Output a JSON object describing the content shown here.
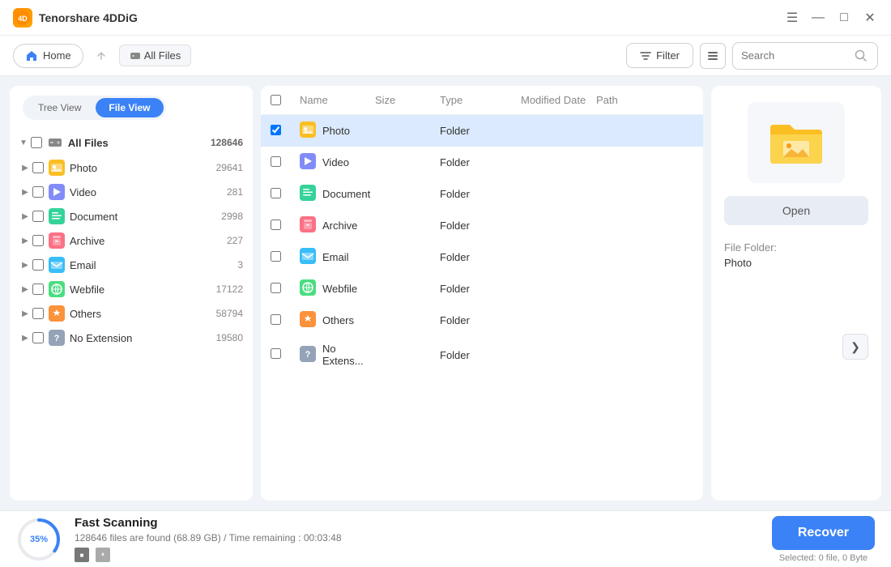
{
  "app": {
    "title": "Tenorshare 4DDiG",
    "logo_text": "4D"
  },
  "titlebar_controls": {
    "menu_label": "☰",
    "minimize_label": "—",
    "maximize_label": "□",
    "close_label": "✕"
  },
  "toolbar": {
    "home_label": "Home",
    "path_label": "All Files",
    "filter_label": "Filter",
    "search_placeholder": "Search"
  },
  "sidebar": {
    "tree_view_label": "Tree View",
    "file_view_label": "File View",
    "root": {
      "label": "All Files",
      "count": "128646"
    },
    "items": [
      {
        "id": "photo",
        "label": "Photo",
        "count": "29641",
        "icon_type": "photo"
      },
      {
        "id": "video",
        "label": "Video",
        "count": "281",
        "icon_type": "video"
      },
      {
        "id": "document",
        "label": "Document",
        "count": "2998",
        "icon_type": "document"
      },
      {
        "id": "archive",
        "label": "Archive",
        "count": "227",
        "icon_type": "archive"
      },
      {
        "id": "email",
        "label": "Email",
        "count": "3",
        "icon_type": "email"
      },
      {
        "id": "webfile",
        "label": "Webfile",
        "count": "17122",
        "icon_type": "webfile"
      },
      {
        "id": "others",
        "label": "Others",
        "count": "58794",
        "icon_type": "others"
      },
      {
        "id": "noext",
        "label": "No Extension",
        "count": "19580",
        "icon_type": "noext"
      }
    ]
  },
  "file_table": {
    "columns": [
      "",
      "Name",
      "Size",
      "Type",
      "Modified Date",
      "Path"
    ],
    "rows": [
      {
        "id": "photo",
        "name": "Photo",
        "size": "",
        "type": "Folder",
        "modified": "",
        "path": "",
        "icon_type": "photo",
        "selected": true
      },
      {
        "id": "video",
        "name": "Video",
        "size": "",
        "type": "Folder",
        "modified": "",
        "path": "",
        "icon_type": "video",
        "selected": false
      },
      {
        "id": "document",
        "name": "Document",
        "size": "",
        "type": "Folder",
        "modified": "",
        "path": "",
        "icon_type": "document",
        "selected": false
      },
      {
        "id": "archive",
        "name": "Archive",
        "size": "",
        "type": "Folder",
        "modified": "",
        "path": "",
        "icon_type": "archive",
        "selected": false
      },
      {
        "id": "email",
        "name": "Email",
        "size": "",
        "type": "Folder",
        "modified": "",
        "path": "",
        "icon_type": "email",
        "selected": false
      },
      {
        "id": "webfile",
        "name": "Webfile",
        "size": "",
        "type": "Folder",
        "modified": "",
        "path": "",
        "icon_type": "webfile",
        "selected": false
      },
      {
        "id": "others",
        "name": "Others",
        "size": "",
        "type": "Folder",
        "modified": "",
        "path": "",
        "icon_type": "others",
        "selected": false
      },
      {
        "id": "noext",
        "name": "No Extens...",
        "size": "",
        "type": "Folder",
        "modified": "",
        "path": "",
        "icon_type": "noext",
        "selected": false
      }
    ]
  },
  "preview": {
    "open_label": "Open",
    "meta_label": "File Folder:",
    "meta_value": "Photo",
    "nav_next_label": "❯"
  },
  "bottom_bar": {
    "scan_title": "Fast Scanning",
    "scan_detail": "128646 files are found (68.89 GB)  /  Time remaining : 00:03:48",
    "percent": "35%",
    "percent_num": 35,
    "recover_label": "Recover",
    "selected_info": "Selected: 0 file, 0 Byte",
    "stop_icon": "■",
    "pause_icon": "⏸"
  }
}
